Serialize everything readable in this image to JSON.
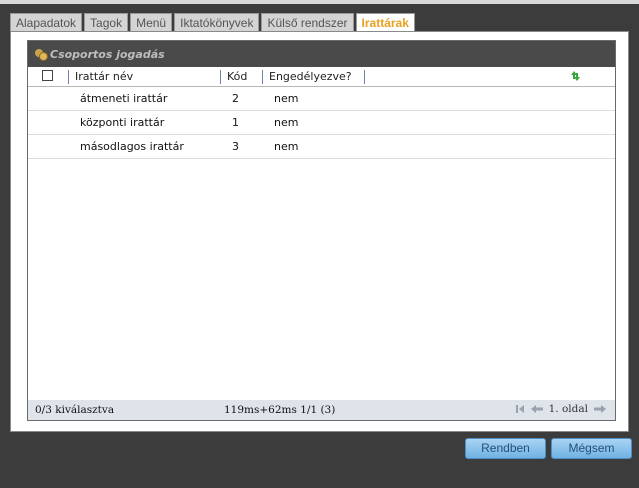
{
  "tabs": [
    {
      "label": "Alapadatok"
    },
    {
      "label": "Tagok"
    },
    {
      "label": "Menü"
    },
    {
      "label": "Iktatókönyvek"
    },
    {
      "label": "Külső rendszer"
    },
    {
      "label": "Irattárak"
    }
  ],
  "active_tab": "Irattárak",
  "grid": {
    "title": "Csoportos jogadás",
    "columns": {
      "name": "Irattár név",
      "code": "Kód",
      "enabled": "Engedélyezve?"
    },
    "rows": [
      {
        "name": "átmeneti irattár",
        "code": "2",
        "enabled": "nem"
      },
      {
        "name": "központi irattár",
        "code": "1",
        "enabled": "nem"
      },
      {
        "name": "másodlagos irattár",
        "code": "3",
        "enabled": "nem"
      }
    ],
    "footer": {
      "selection": "0/3 kiválasztva",
      "timing": "119ms+62ms 1/1 (3)",
      "page": "1. oldal"
    }
  },
  "buttons": {
    "ok": "Rendben",
    "cancel": "Mégsem"
  },
  "colors": {
    "active_tab_text": "#e8a020",
    "button_bg": "#8cc3ec",
    "refresh_icon": "#3aa53a"
  }
}
